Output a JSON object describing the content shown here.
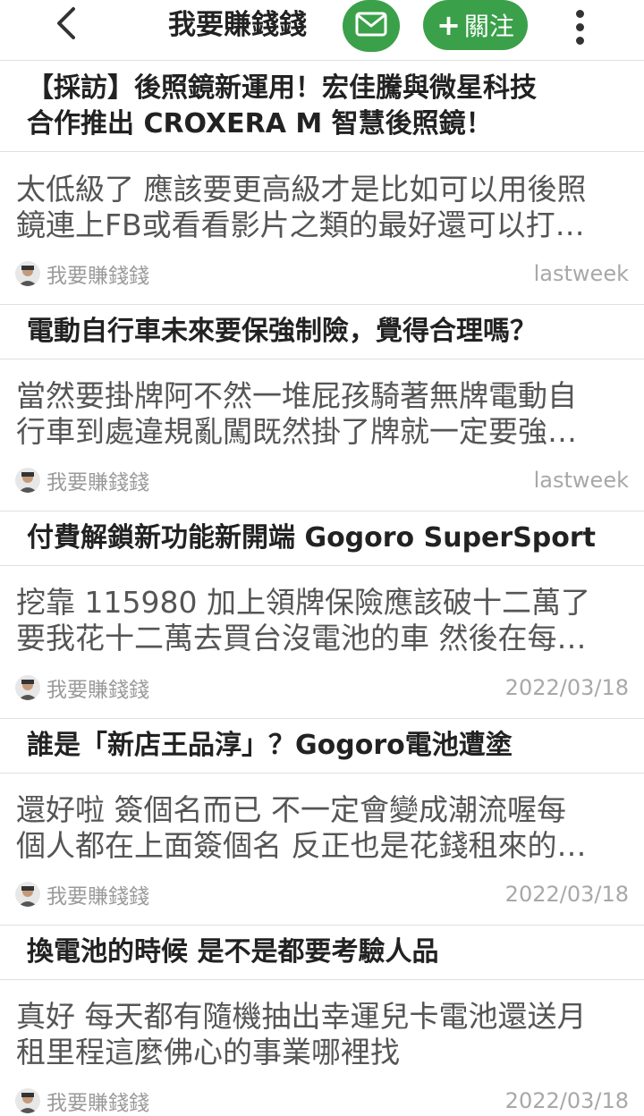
{
  "header": {
    "title": "我要賺錢錢",
    "follow_label": "關注",
    "accent_color": "#3ba04a"
  },
  "icons": {
    "back": "chevron-left-icon",
    "mail": "envelope-icon",
    "more": "vertical-dots-icon"
  },
  "topics": [
    {
      "title_lines": [
        "【採訪】後照鏡新運用！宏佳騰與微星科技",
        "合作推出 CROXERA M 智慧後照鏡！"
      ],
      "reply_lines": [
        "太低級了 應該要更高級才是比如可以用後照",
        "鏡連上FB或看看影片之類的最好還可以打…"
      ],
      "author": "我要賺錢錢",
      "time": "lastweek"
    },
    {
      "title_lines": [
        "電動自行車未來要保強制險，覺得合理嗎？"
      ],
      "reply_lines": [
        "當然要掛牌阿不然一堆屁孩騎著無牌電動自",
        "行車到處違規亂闖既然掛了牌就一定要強…"
      ],
      "author": "我要賺錢錢",
      "time": "lastweek"
    },
    {
      "title_lines": [
        "付費解鎖新功能新開端 Gogoro SuperSport"
      ],
      "reply_lines": [
        "挖靠 115980 加上領牌保險應該破十二萬了",
        "要我花十二萬去買台沒電池的車 然後在每…"
      ],
      "author": "我要賺錢錢",
      "time": "2022/03/18"
    },
    {
      "title_lines": [
        "誰是「新店王品淳」？Gogoro電池遭塗"
      ],
      "reply_lines": [
        "還好啦 簽個名而已 不一定會變成潮流喔每",
        "個人都在上面簽個名 反正也是花錢租來的…"
      ],
      "author": "我要賺錢錢",
      "time": "2022/03/18"
    },
    {
      "title_lines": [
        "換電池的時候 是不是都要考驗人品"
      ],
      "reply_lines": [
        "真好 每天都有隨機抽出幸運兒卡電池還送月",
        "租里程這麼佛心的事業哪裡找"
      ],
      "author": "我要賺錢錢",
      "time": "2022/03/18"
    }
  ]
}
